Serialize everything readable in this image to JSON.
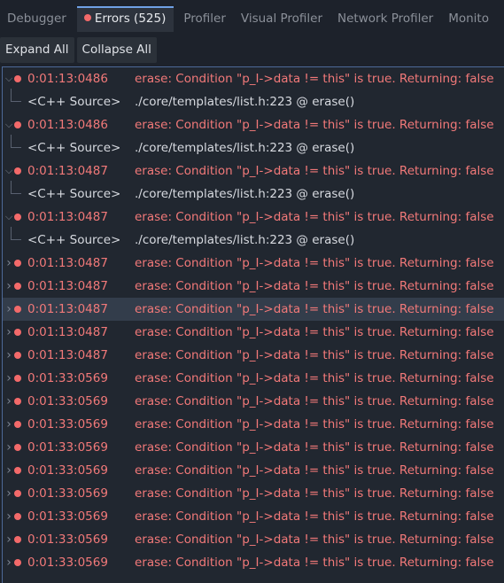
{
  "tabs": [
    {
      "label": "Debugger"
    },
    {
      "label": "Errors (525)"
    },
    {
      "label": "Profiler"
    },
    {
      "label": "Visual Profiler"
    },
    {
      "label": "Network Profiler"
    },
    {
      "label": "Monito"
    }
  ],
  "toolbar": {
    "expand_label": "Expand All",
    "collapse_label": "Collapse All"
  },
  "rows": [
    {
      "time": "0:01:13:0486",
      "msg": "erase: Condition \"p_I->data != this\" is true. Returning: false",
      "expanded": true,
      "src": "<C++ Source>",
      "loc": "./core/templates/list.h:223 @ erase()"
    },
    {
      "time": "0:01:13:0486",
      "msg": "erase: Condition \"p_I->data != this\" is true. Returning: false",
      "expanded": true,
      "src": "<C++ Source>",
      "loc": "./core/templates/list.h:223 @ erase()"
    },
    {
      "time": "0:01:13:0487",
      "msg": "erase: Condition \"p_I->data != this\" is true. Returning: false",
      "expanded": true,
      "src": "<C++ Source>",
      "loc": "./core/templates/list.h:223 @ erase()"
    },
    {
      "time": "0:01:13:0487",
      "msg": "erase: Condition \"p_I->data != this\" is true. Returning: false",
      "expanded": true,
      "src": "<C++ Source>",
      "loc": "./core/templates/list.h:223 @ erase()"
    },
    {
      "time": "0:01:13:0487",
      "msg": "erase: Condition \"p_I->data != this\" is true. Returning: false"
    },
    {
      "time": "0:01:13:0487",
      "msg": "erase: Condition \"p_I->data != this\" is true. Returning: false"
    },
    {
      "time": "0:01:13:0487",
      "msg": "erase: Condition \"p_I->data != this\" is true. Returning: false",
      "selected": true
    },
    {
      "time": "0:01:13:0487",
      "msg": "erase: Condition \"p_I->data != this\" is true. Returning: false"
    },
    {
      "time": "0:01:13:0487",
      "msg": "erase: Condition \"p_I->data != this\" is true. Returning: false"
    },
    {
      "time": "0:01:33:0569",
      "msg": "erase: Condition \"p_I->data != this\" is true. Returning: false"
    },
    {
      "time": "0:01:33:0569",
      "msg": "erase: Condition \"p_I->data != this\" is true. Returning: false"
    },
    {
      "time": "0:01:33:0569",
      "msg": "erase: Condition \"p_I->data != this\" is true. Returning: false"
    },
    {
      "time": "0:01:33:0569",
      "msg": "erase: Condition \"p_I->data != this\" is true. Returning: false"
    },
    {
      "time": "0:01:33:0569",
      "msg": "erase: Condition \"p_I->data != this\" is true. Returning: false"
    },
    {
      "time": "0:01:33:0569",
      "msg": "erase: Condition \"p_I->data != this\" is true. Returning: false"
    },
    {
      "time": "0:01:33:0569",
      "msg": "erase: Condition \"p_I->data != this\" is true. Returning: false"
    },
    {
      "time": "0:01:33:0569",
      "msg": "erase: Condition \"p_I->data != this\" is true. Returning: false"
    },
    {
      "time": "0:01:33:0569",
      "msg": "erase: Condition \"p_I->data != this\" is true. Returning: false"
    }
  ]
}
